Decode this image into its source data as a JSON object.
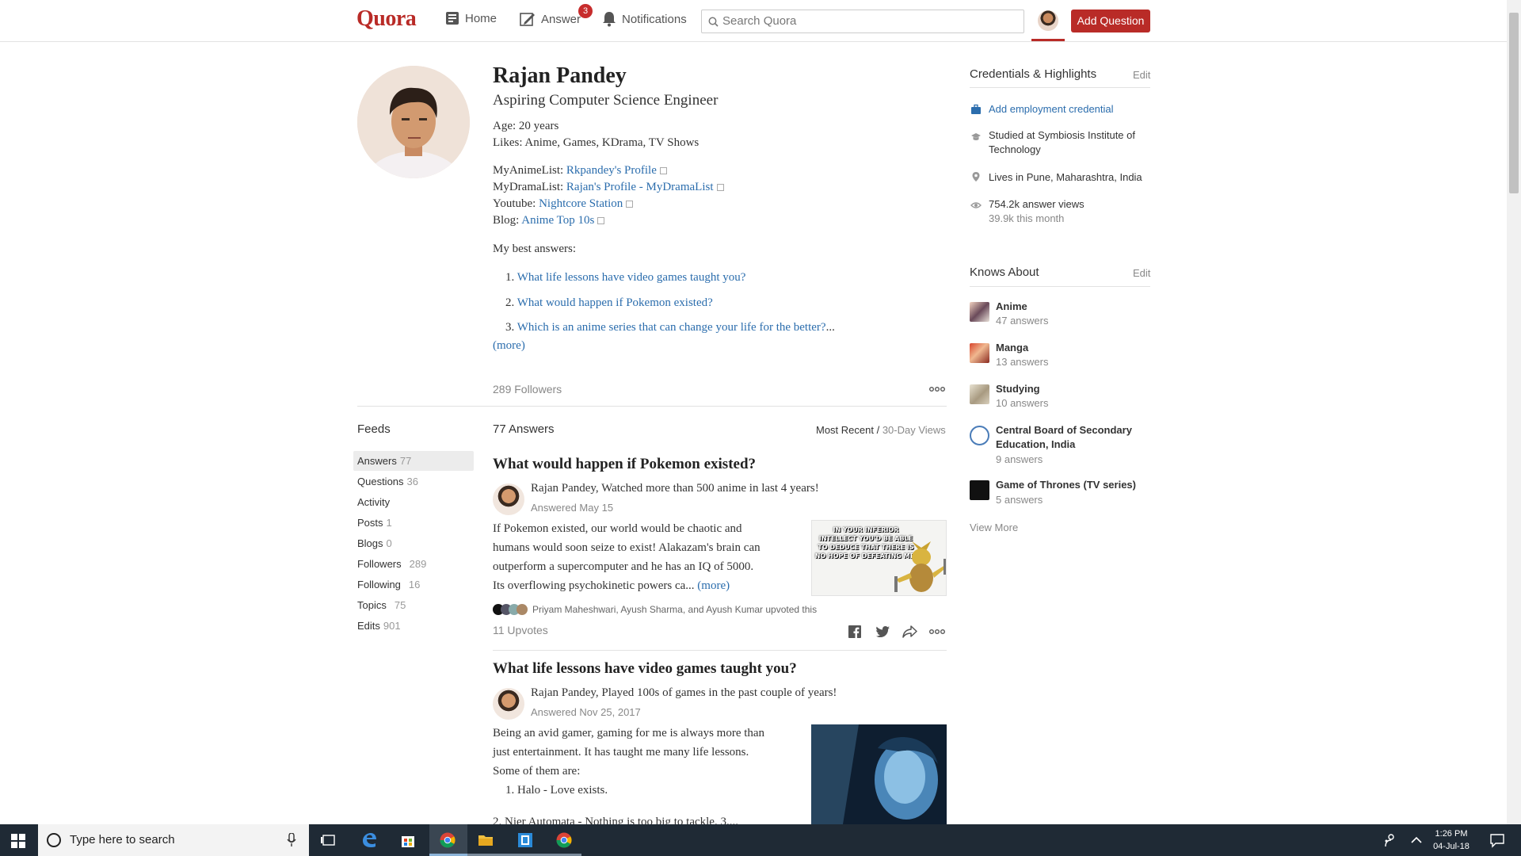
{
  "header": {
    "logo": "Quora",
    "nav": {
      "home": "Home",
      "answer": "Answer",
      "answer_badge": "3",
      "notifications": "Notifications"
    },
    "search_placeholder": "Search Quora",
    "add_question": "Add Question"
  },
  "profile": {
    "name": "Rajan Pandey",
    "tagline": "Aspiring Computer Science Engineer",
    "age": "Age: 20 years",
    "likes": "Likes: Anime, Games, KDrama, TV Shows",
    "links": [
      {
        "label": "MyAnimeList:",
        "text": "Rkpandey's Profile"
      },
      {
        "label": "MyDramaList:",
        "text": "Rajan's Profile - MyDramaList"
      },
      {
        "label": "Youtube:",
        "text": "Nightcore Station"
      },
      {
        "label": "Blog:",
        "text": "Anime Top 10s"
      }
    ],
    "best_label": "My best answers:",
    "best_answers": [
      {
        "num": "1.",
        "text": "What life lessons have video games taught you?",
        "tail": ""
      },
      {
        "num": "2.",
        "text": "What would happen if Pokemon existed?",
        "tail": ""
      },
      {
        "num": "3.",
        "text": "Which is an anime series that can change your life for the better?",
        "tail": "..."
      }
    ],
    "more": "(more)",
    "followers": "289 Followers"
  },
  "credentials": {
    "title": "Credentials & Highlights",
    "edit": "Edit",
    "add_employment": "Add employment credential",
    "studied": "Studied at Symbiosis Institute of Technology",
    "lives": "Lives in Pune, Maharashtra, India",
    "views": "754.2k answer views",
    "views_month": "39.9k this month"
  },
  "knows": {
    "title": "Knows About",
    "edit": "Edit",
    "topics": [
      {
        "name": "Anime",
        "count": "47 answers"
      },
      {
        "name": "Manga",
        "count": "13 answers"
      },
      {
        "name": "Studying",
        "count": "10 answers"
      },
      {
        "name": "Central Board of Secondary Education, India",
        "count": "9 answers"
      },
      {
        "name": "Game of Thrones (TV series)",
        "count": "5 answers"
      }
    ],
    "view_more": "View More"
  },
  "feeds": {
    "title": "Feeds",
    "items": [
      {
        "label": "Answers",
        "count": "77"
      },
      {
        "label": "Questions",
        "count": "36"
      },
      {
        "label": "Activity",
        "count": ""
      },
      {
        "label": "Posts",
        "count": "1"
      },
      {
        "label": "Blogs",
        "count": "0"
      },
      {
        "label": "Followers",
        "count": "289"
      },
      {
        "label": "Following",
        "count": "16"
      },
      {
        "label": "Topics",
        "count": "75"
      },
      {
        "label": "Edits",
        "count": "901"
      }
    ]
  },
  "answers_header": {
    "count": "77 Answers",
    "sort_active": "Most Recent",
    "sep": " / ",
    "sort_other": "30-Day Views"
  },
  "answers": [
    {
      "title": "What would happen if Pokemon existed?",
      "author": "Rajan Pandey, Watched more than 500 anime in last 4 years!",
      "date": "Answered May 15",
      "lines": [
        "If Pokemon existed, our world would be chaotic and",
        "humans would soon seize to exist! Alakazam's brain can",
        "outperform a supercomputer and he has an IQ of 5000.",
        "Its overflowing psychokinetic powers ca..."
      ],
      "more": "(more)",
      "image_text": "IN YOUR INFERIOR INTELLECT YOU'D BE ABLE TO DEDUCE THAT THERE IS NO HOPE OF DEFEATING ME.",
      "upvoters": "Priyam Maheshwari, Ayush Sharma, and Ayush Kumar upvoted this",
      "upvotes": "11 Upvotes"
    },
    {
      "title": "What life lessons have video games taught you?",
      "author": "Rajan Pandey, Played 100s of games in the past couple of years!",
      "date": "Answered Nov 25, 2017",
      "lines": [
        "Being an avid gamer, gaming for me is always more than",
        "just entertainment. It has taught me many life lessons.",
        "Some of them are:"
      ],
      "list1": "1. Halo - Love exists.",
      "list2": "2. Nier Automata - Nothing is too big to tackle. 3...."
    }
  ],
  "taskbar": {
    "search": "Type here to search",
    "time": "1:26 PM",
    "date": "04-Jul-18"
  }
}
